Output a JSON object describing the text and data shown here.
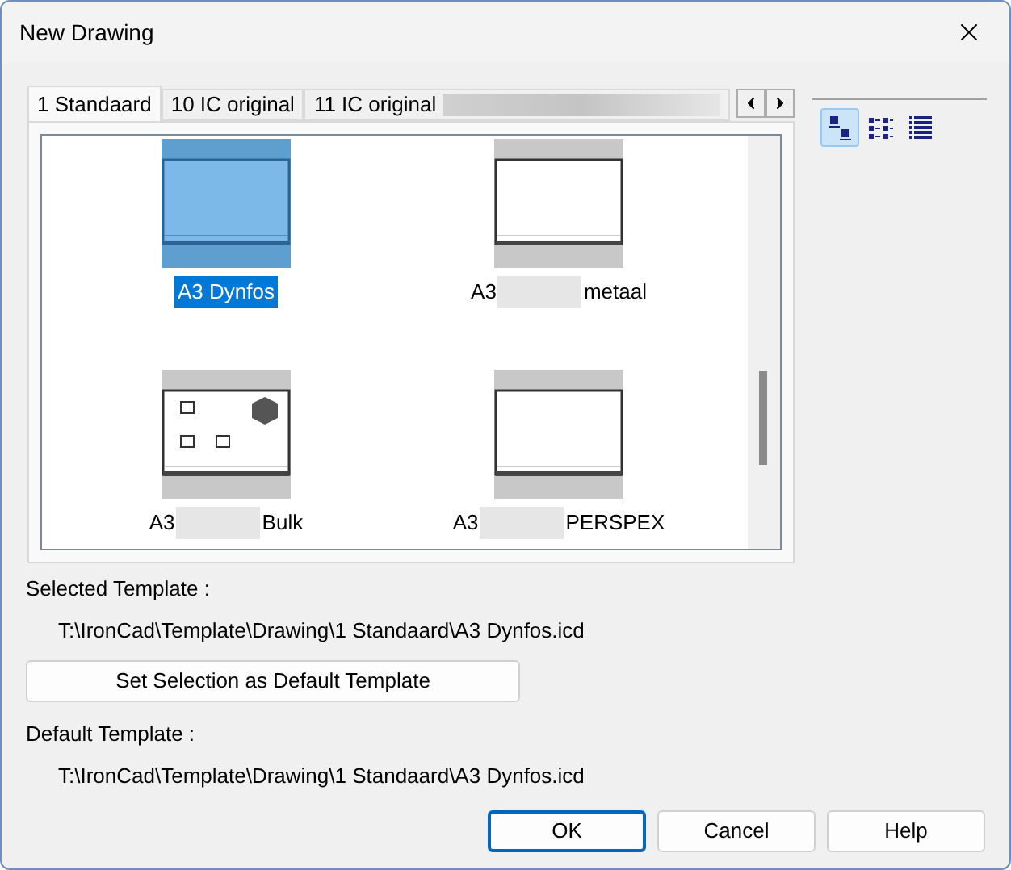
{
  "window": {
    "title": "New Drawing"
  },
  "tabs": [
    {
      "label": "1 Standaard",
      "selected": true
    },
    {
      "label": "10 IC original",
      "selected": false
    },
    {
      "label": "11 IC original",
      "selected": false,
      "redacted": true
    }
  ],
  "templates": [
    {
      "prefix": "A3",
      "name": "Dynfos",
      "redacted": false,
      "selected": true,
      "kind": "plain"
    },
    {
      "prefix": "A3",
      "name": "metaal",
      "redacted": true,
      "selected": false,
      "kind": "plain"
    },
    {
      "prefix": "A3",
      "name": "Bulk",
      "redacted": true,
      "selected": false,
      "kind": "symbols"
    },
    {
      "prefix": "A3",
      "name": "PERSPEX",
      "redacted": true,
      "selected": false,
      "kind": "plain"
    }
  ],
  "view_modes": [
    {
      "kind": "large",
      "selected": true
    },
    {
      "kind": "list",
      "selected": false
    },
    {
      "kind": "details",
      "selected": false
    }
  ],
  "selected_template": {
    "label": "Selected Template :",
    "path": "T:\\IronCad\\Template\\Drawing\\1 Standaard\\A3 Dynfos.icd"
  },
  "set_default_button": "Set Selection as Default Template",
  "default_template": {
    "label": "Default Template :",
    "path": "T:\\IronCad\\Template\\Drawing\\1 Standaard\\A3 Dynfos.icd"
  },
  "buttons": [
    {
      "label": "OK",
      "default": true
    },
    {
      "label": "Cancel",
      "default": false
    },
    {
      "label": "Help",
      "default": false
    }
  ]
}
